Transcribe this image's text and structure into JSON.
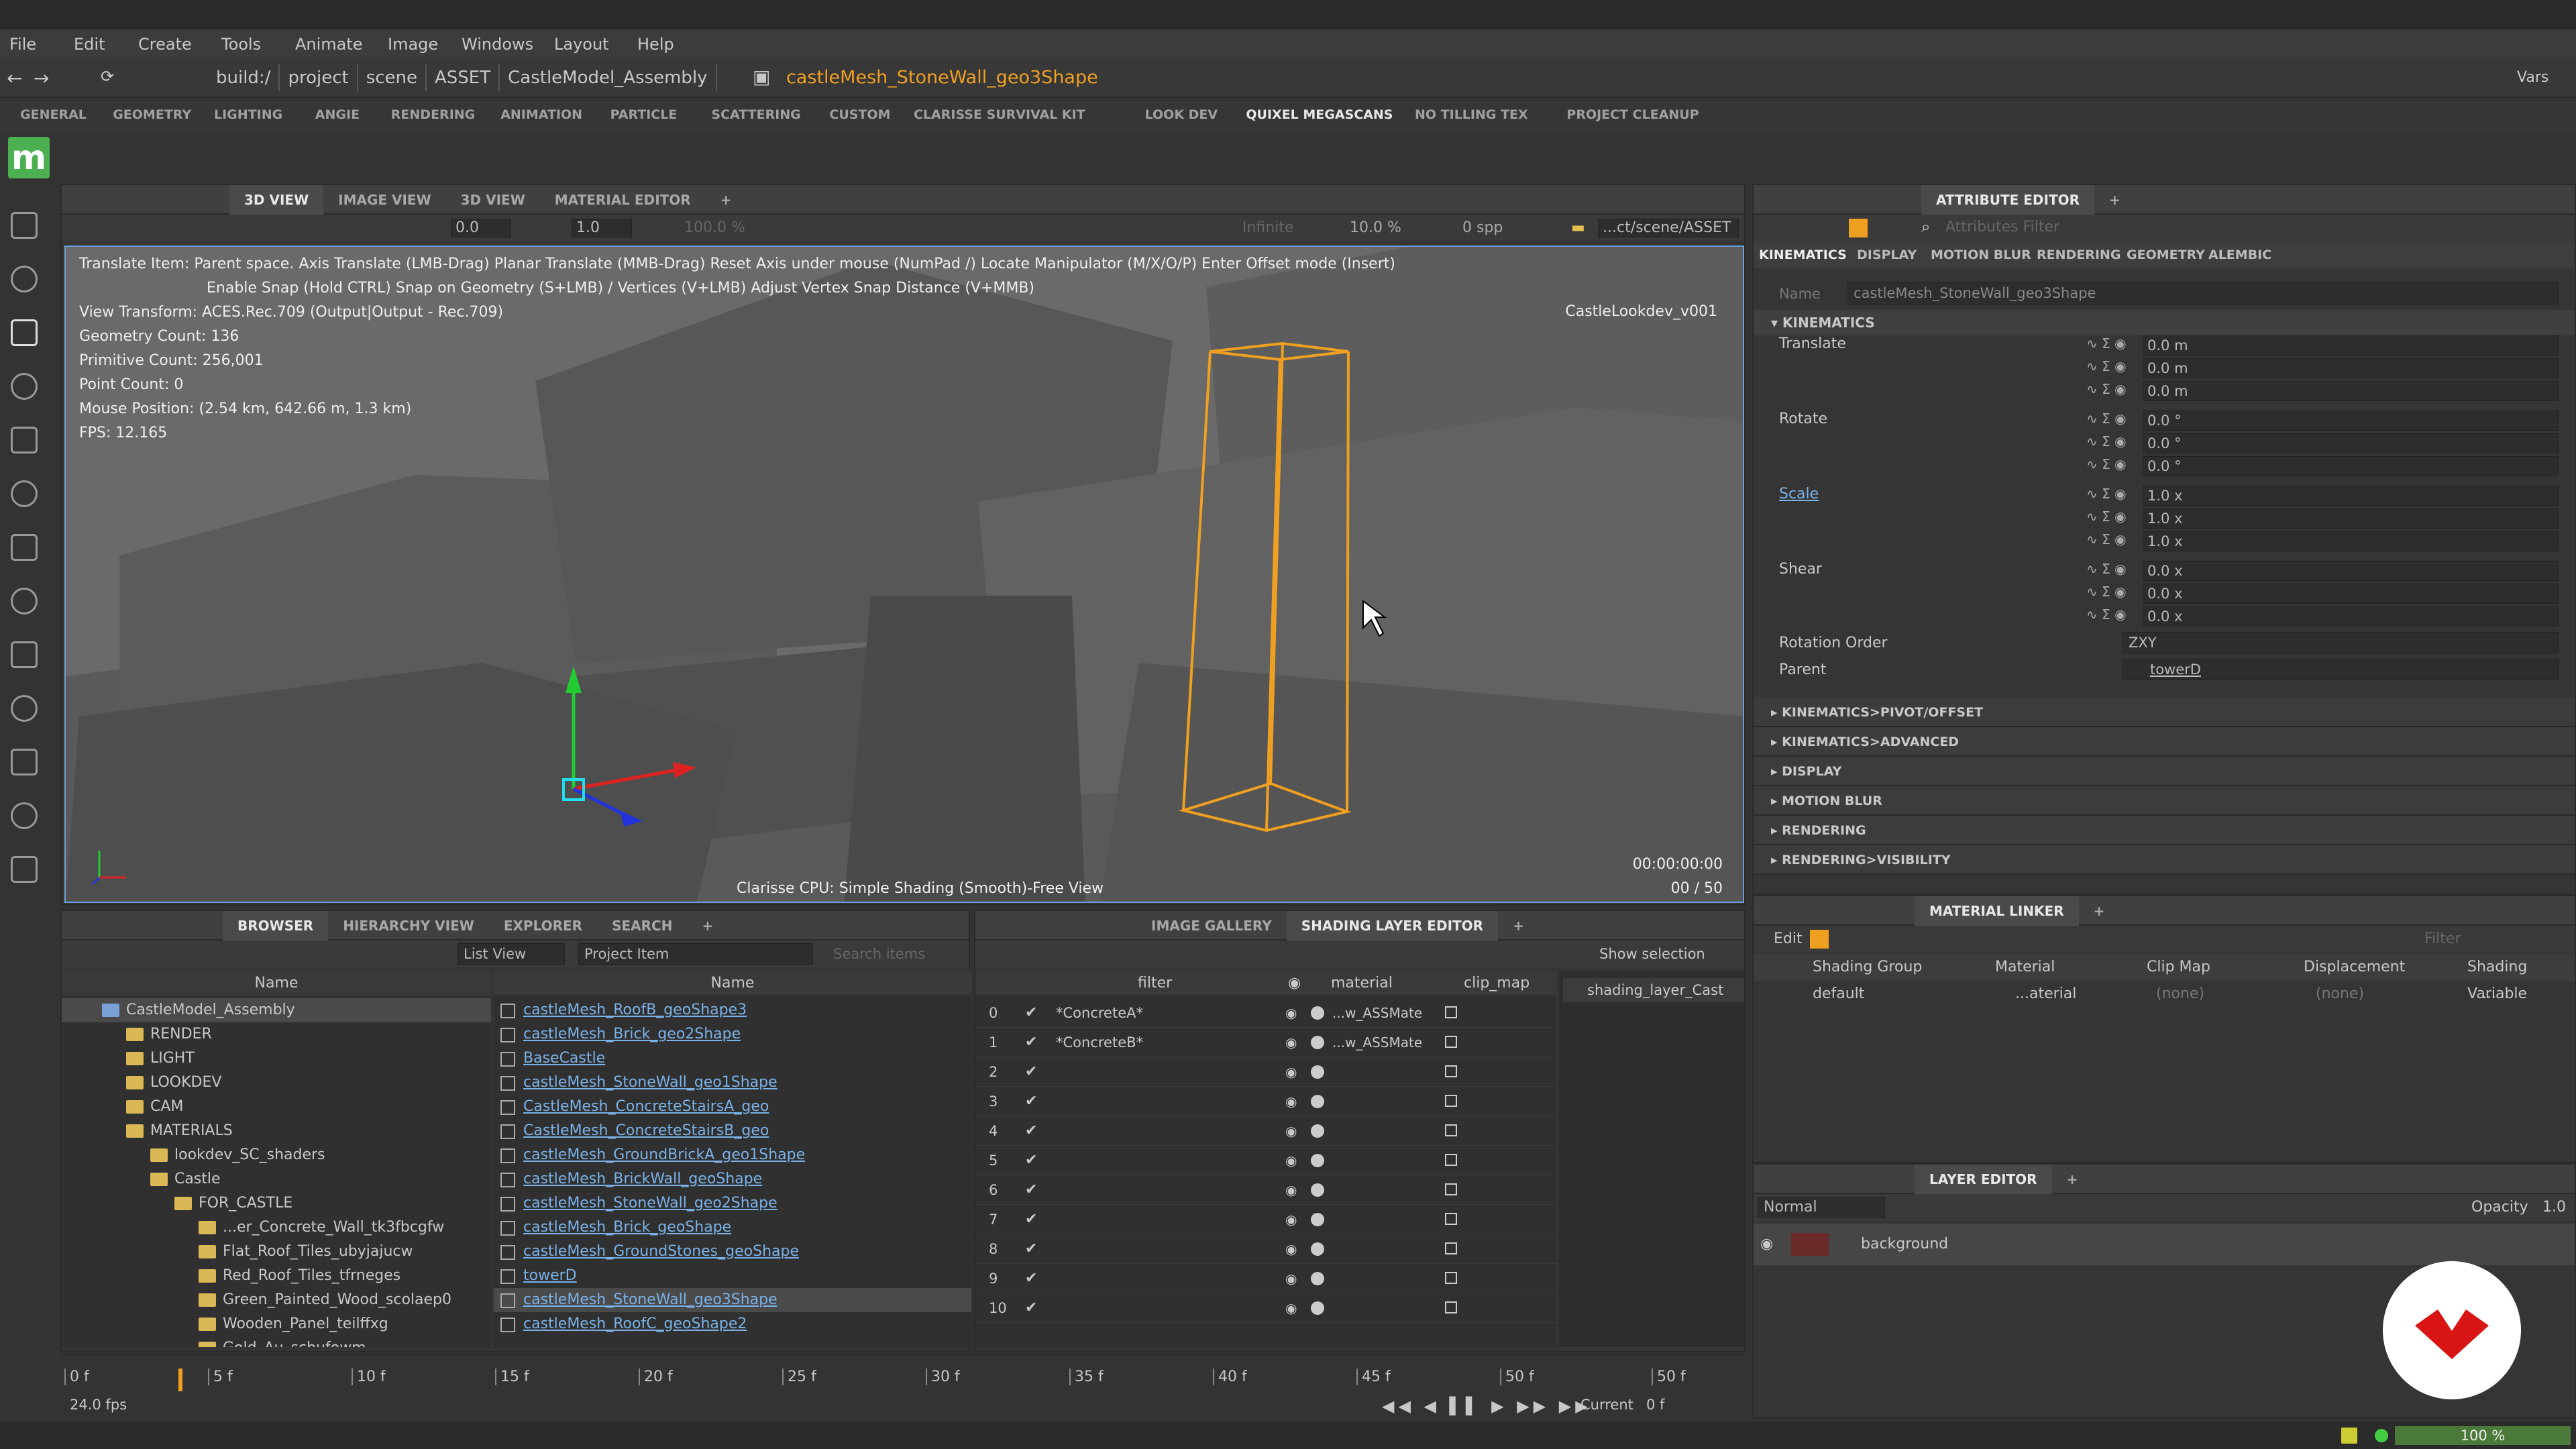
{
  "menu": [
    "File",
    "Edit",
    "Create",
    "Tools",
    "Animate",
    "Image",
    "Windows",
    "Layout",
    "Help"
  ],
  "path": {
    "segments": [
      "build:/",
      "project",
      "scene",
      "ASSET",
      "CastleModel_Assembly"
    ],
    "current": "castleMesh_StoneWall_geo3Shape",
    "vars": "Vars"
  },
  "shelf_tabs": [
    "GENERAL",
    "GEOMETRY",
    "LIGHTING",
    "ANGIE",
    "RENDERING",
    "ANIMATION",
    "PARTICLE",
    "SCATTERING",
    "CUSTOM",
    "CLARISSE SURVIVAL KIT",
    "LOOK DEV",
    "QUIXEL MEGASCANS",
    "NO TILLING TEX",
    "PROJECT CLEANUP"
  ],
  "viewport": {
    "tabs": [
      "3D VIEW",
      "IMAGE VIEW",
      "3D VIEW",
      "MATERIAL EDITOR",
      "+"
    ],
    "tool_fields": {
      "a": "0.0",
      "b": "1.0",
      "c": "100.0 %",
      "d": "Infinite",
      "e": "10.0 %",
      "f": "0 spp",
      "path": "...ct/scene/ASSET"
    },
    "help1": "Translate Item: Parent space. Axis Translate (LMB-Drag)  Planar Translate (MMB-Drag) Reset Axis under mouse (NumPad /)  Locate Manipulator (M/X/O/P)  Enter Offset mode (Insert)",
    "help2": "Enable Snap (Hold CTRL) Snap on Geometry (S+LMB) / Vertices (V+LMB) Adjust Vertex Snap Distance (V+MMB)",
    "stats": [
      "View Transform: ACES.Rec.709 (Output|Output - Rec.709)",
      "Geometry Count: 136",
      "Primitive Count: 256,001",
      "Point Count: 0",
      "Mouse Position:  (2.54 km, 642.66 m, 1.3 km)",
      "FPS: 12.165"
    ],
    "camera": "CastleLookdev_v001",
    "timecode": "00:00:00:00",
    "frame": "00 / 50",
    "status": "Clarisse CPU: Simple Shading (Smooth)-Free View"
  },
  "attr": {
    "tabs": [
      "ATTRIBUTE EDITOR",
      "+"
    ],
    "filter_placeholder": "Attributes Filter",
    "subtabs": [
      "KINEMATICS",
      "DISPLAY",
      "MOTION BLUR",
      "RENDERING",
      "GEOMETRY",
      "ALEMBIC"
    ],
    "name_label": "Name",
    "name_value": "castleMesh_StoneWall_geo3Shape",
    "section": "KINEMATICS",
    "translate_label": "Translate",
    "translate": [
      "0.0 m",
      "0.0 m",
      "0.0 m"
    ],
    "rotate_label": "Rotate",
    "rotate": [
      "0.0 °",
      "0.0 °",
      "0.0 °"
    ],
    "scale_label": "Scale",
    "scale": [
      "1.0 x",
      "1.0 x",
      "1.0 x"
    ],
    "shear_label": "Shear",
    "shear": [
      "0.0 x",
      "0.0 x",
      "0.0 x"
    ],
    "rotorder_label": "Rotation Order",
    "rotorder": "ZXY",
    "parent_label": "Parent",
    "parent": "towerD",
    "collapsed": [
      "KINEMATICS>PIVOT/OFFSET",
      "KINEMATICS>ADVANCED",
      "DISPLAY",
      "MOTION BLUR",
      "RENDERING",
      "RENDERING>VISIBILITY"
    ]
  },
  "matlinker": {
    "tabs": [
      "MATERIAL LINKER",
      "+"
    ],
    "edit": "Edit",
    "filter_placeholder": "Filter",
    "cols": [
      "Shading Group",
      "Material",
      "Clip Map",
      "Displacement",
      "Shading Variable"
    ],
    "row": {
      "group": "default",
      "material": "...aterial",
      "clip": "(none)",
      "disp": "(none)",
      "var": "..."
    }
  },
  "layer": {
    "tabs": [
      "LAYER EDITOR",
      "+"
    ],
    "mode": "Normal",
    "opacity_label": "Opacity",
    "opacity": "1.0",
    "item": "background"
  },
  "browser": {
    "tabs": [
      "BROWSER",
      "HIERARCHY VIEW",
      "EXPLORER",
      "SEARCH",
      "+"
    ],
    "view": "List View",
    "filter": "Project Item",
    "search_placeholder": "Search items",
    "col_name": "Name",
    "tree": [
      {
        "t": "CastleModel_Assembly",
        "d": 0,
        "sel": true
      },
      {
        "t": "RENDER",
        "d": 1
      },
      {
        "t": "LIGHT",
        "d": 1
      },
      {
        "t": "LOOKDEV",
        "d": 1
      },
      {
        "t": "CAM",
        "d": 1
      },
      {
        "t": "MATERIALS",
        "d": 1
      },
      {
        "t": "lookdev_SC_shaders",
        "d": 2
      },
      {
        "t": "Castle",
        "d": 2
      },
      {
        "t": "FOR_CASTLE",
        "d": 3
      },
      {
        "t": "...er_Concrete_Wall_tk3fbcgfw",
        "d": 4
      },
      {
        "t": "Flat_Roof_Tiles_ubyjajucw",
        "d": 4
      },
      {
        "t": "Red_Roof_Tiles_tfrneges",
        "d": 4
      },
      {
        "t": "Green_Painted_Wood_scolaep0",
        "d": 4
      },
      {
        "t": "Wooden_Panel_teilffxg",
        "d": 4
      },
      {
        "t": "Gold_Au_schufowm",
        "d": 4
      }
    ],
    "items": [
      "castleMesh_RoofB_geoShape3",
      "castleMesh_Brick_geo2Shape",
      "BaseCastle",
      "castleMesh_StoneWall_geo1Shape",
      "CastleMesh_ConcreteStairsA_geo",
      "CastleMesh_ConcreteStairsB_geo",
      "castleMesh_GroundBrickA_geo1Shape",
      "castleMesh_BrickWall_geoShape",
      "castleMesh_StoneWall_geo2Shape",
      "castleMesh_Brick_geoShape",
      "castleMesh_GroundStones_geoShape",
      "towerD",
      "castleMesh_StoneWall_geo3Shape",
      "castleMesh_RoofC_geoShape2"
    ]
  },
  "shading": {
    "tabs": [
      "IMAGE GALLERY",
      "SHADING LAYER EDITOR",
      "+"
    ],
    "show": "Show selection",
    "cols": {
      "filter": "filter",
      "material": "material",
      "clip": "clip_map"
    },
    "rows": [
      {
        "n": "0",
        "f": "*ConcreteA*",
        "m": "...w_ASSMate"
      },
      {
        "n": "1",
        "f": "*ConcreteB*",
        "m": "...w_ASSMate"
      },
      {
        "n": "2",
        "f": "",
        "m": ""
      },
      {
        "n": "3",
        "f": "",
        "m": ""
      },
      {
        "n": "4",
        "f": "",
        "m": ""
      },
      {
        "n": "5",
        "f": "",
        "m": ""
      },
      {
        "n": "6",
        "f": "",
        "m": ""
      },
      {
        "n": "7",
        "f": "",
        "m": ""
      },
      {
        "n": "8",
        "f": "",
        "m": ""
      },
      {
        "n": "9",
        "f": "",
        "m": ""
      },
      {
        "n": "10",
        "f": "",
        "m": ""
      }
    ],
    "side": "shading_layer_Cast"
  },
  "timeline": {
    "ticks": [
      "0 f",
      "5 f",
      "10 f",
      "15 f",
      "20 f",
      "25 f",
      "30 f",
      "35 f",
      "40 f",
      "45 f",
      "50 f",
      "50 f"
    ],
    "start": "0 f",
    "fps": "24.0 fps",
    "current_label": "Current",
    "current": "0 f"
  },
  "statusbar": {
    "zoom": "100 %"
  },
  "colors": {
    "accent": "#f0a020",
    "link": "#7ab2e8",
    "bg": "#333333",
    "panel": "#3c3c3c"
  }
}
